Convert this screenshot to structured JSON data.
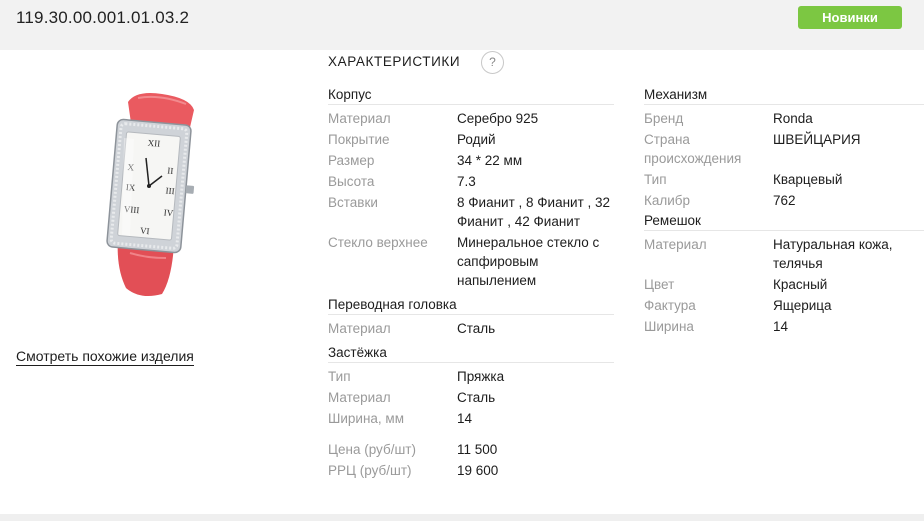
{
  "header": {
    "sku": "119.30.00.001.01.03.2",
    "badge": "Новинки"
  },
  "product": {
    "similar_link": "Смотреть похожие изделия"
  },
  "specs": {
    "title": "ХАРАКТЕРИСТИКИ",
    "help": "?",
    "left": {
      "korpus": {
        "heading": "Корпус",
        "rows": [
          {
            "k": "Материал",
            "v": "Серебро 925"
          },
          {
            "k": "Покрытие",
            "v": "Родий"
          },
          {
            "k": "Размер",
            "v": "34 * 22 мм"
          },
          {
            "k": "Высота",
            "v": "7.3"
          },
          {
            "k": "Вставки",
            "v": "8 Фианит , 8 Фианит , 32 Фианит , 42 Фианит"
          },
          {
            "k": "Стекло верхнее",
            "v": "Минеральное стекло с сапфировым напылением"
          }
        ]
      },
      "golovka": {
        "heading": "Переводная головка",
        "rows": [
          {
            "k": "Материал",
            "v": "Сталь"
          }
        ]
      },
      "zastezhka": {
        "heading": "Застёжка",
        "rows": [
          {
            "k": "Тип",
            "v": "Пряжка"
          },
          {
            "k": "Материал",
            "v": "Сталь"
          },
          {
            "k": "Ширина, мм",
            "v": "14"
          }
        ]
      },
      "prices": [
        {
          "k": "Цена (руб/шт)",
          "v": "11 500"
        },
        {
          "k": "РРЦ (руб/шт)",
          "v": "19 600"
        }
      ]
    },
    "right": {
      "mehanizm": {
        "heading": "Механизм",
        "rows": [
          {
            "k": "Бренд",
            "v": "Ronda"
          },
          {
            "k": "Страна происхождения",
            "v": "ШВЕЙЦАРИЯ"
          },
          {
            "k": "Тип",
            "v": "Кварцевый"
          },
          {
            "k": "Калибр",
            "v": "762"
          }
        ]
      },
      "remeshok": {
        "heading": "Ремешок",
        "rows": [
          {
            "k": "Материал",
            "v": "Натуральная кожа, телячья"
          },
          {
            "k": "Цвет",
            "v": "Красный"
          },
          {
            "k": "Фактура",
            "v": "Ящерица"
          },
          {
            "k": "Ширина",
            "v": "14"
          }
        ]
      }
    }
  }
}
